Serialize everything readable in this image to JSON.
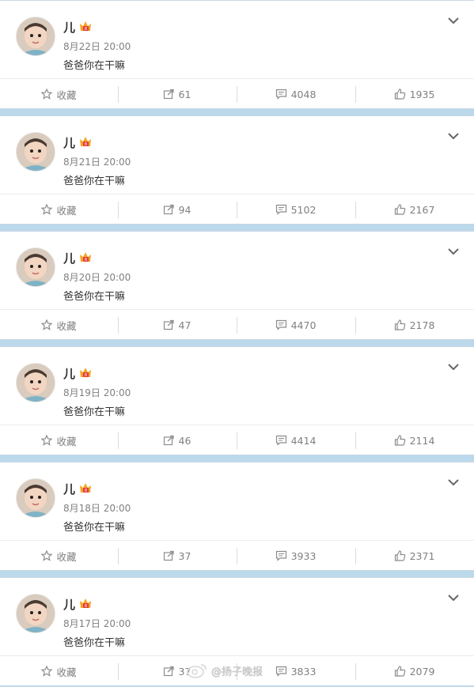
{
  "labels": {
    "favorite": "收藏"
  },
  "posts": [
    {
      "name": "儿",
      "time": "8月22日 20:00",
      "text": "爸爸你在干嘛",
      "reposts": "61",
      "comments": "4048",
      "likes": "1935"
    },
    {
      "name": "儿",
      "time": "8月21日 20:00",
      "text": "爸爸你在干嘛",
      "reposts": "94",
      "comments": "5102",
      "likes": "2167"
    },
    {
      "name": "儿",
      "time": "8月20日 20:00",
      "text": "爸爸你在干嘛",
      "reposts": "47",
      "comments": "4470",
      "likes": "2178"
    },
    {
      "name": "儿",
      "time": "8月19日 20:00",
      "text": "爸爸你在干嘛",
      "reposts": "46",
      "comments": "4414",
      "likes": "2114"
    },
    {
      "name": "儿",
      "time": "8月18日 20:00",
      "text": "爸爸你在干嘛",
      "reposts": "37",
      "comments": "3933",
      "likes": "2371"
    },
    {
      "name": "儿",
      "time": "8月17日 20:00",
      "text": "爸爸你在干嘛",
      "reposts": "37",
      "comments": "3833",
      "likes": "2079"
    }
  ],
  "watermark": "@扬子晚报",
  "colors": {
    "page_bg": "#bcd9ec",
    "vip": "#f5a623",
    "icon": "#8c8c8c"
  }
}
